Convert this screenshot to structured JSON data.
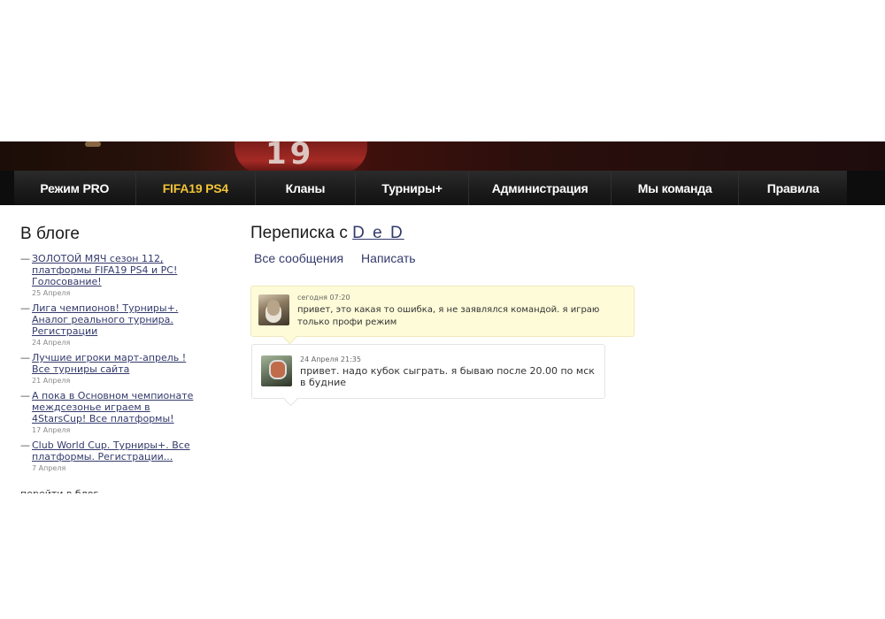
{
  "nav": {
    "items": [
      {
        "label": "Режим PRO",
        "active": false
      },
      {
        "label": "FIFA19 PS4",
        "active": true
      },
      {
        "label": "Кланы",
        "active": false
      },
      {
        "label": "Турниры+",
        "active": false
      },
      {
        "label": "Администрация",
        "active": false
      },
      {
        "label": "Мы команда",
        "active": false
      },
      {
        "label": "Правила",
        "active": false
      }
    ],
    "active_color": "#f2c335"
  },
  "sidebar": {
    "title": "В блоге",
    "items": [
      {
        "dash": "—",
        "title": "ЗОЛОТОЙ МЯЧ сезон 112, платформы FIFA19 PS4 и PC! Голосование!",
        "date": "25 Апреля"
      },
      {
        "dash": "—",
        "title": "Лига чемпионов! Турниры+. Аналог реального турнира. Регистрации",
        "date": "24 Апреля"
      },
      {
        "dash": "—",
        "title": "Лучшие игроки март-апрель ! Все турниры сайта",
        "date": "21 Апреля"
      },
      {
        "dash": "—",
        "title": "А пока в Основном чемпионате междсезонье играем в 4StarsCup! Все платформы!",
        "date": "17 Апреля"
      },
      {
        "dash": "—",
        "title": "Club World Cup. Турниры+. Все платформы. Регистрации...",
        "date": "7 Апреля"
      }
    ],
    "more": "перейти в блог"
  },
  "conversation": {
    "title_prefix": "Переписка с",
    "user": "D e D",
    "tabs": {
      "all": "Все сообщения",
      "write": "Написать"
    },
    "messages": [
      {
        "time": "сегодня 07:20",
        "text": "привет, это какая то ошибка, я не заявлялся командой. я играю только профи режим",
        "avatar": "user-avatar-icon"
      },
      {
        "time": "24 Апреля 21:35",
        "text": "привет. надо кубок сыграть. я бываю после 20.00 по мск в будние",
        "avatar": "user-avatar-icon"
      }
    ]
  }
}
